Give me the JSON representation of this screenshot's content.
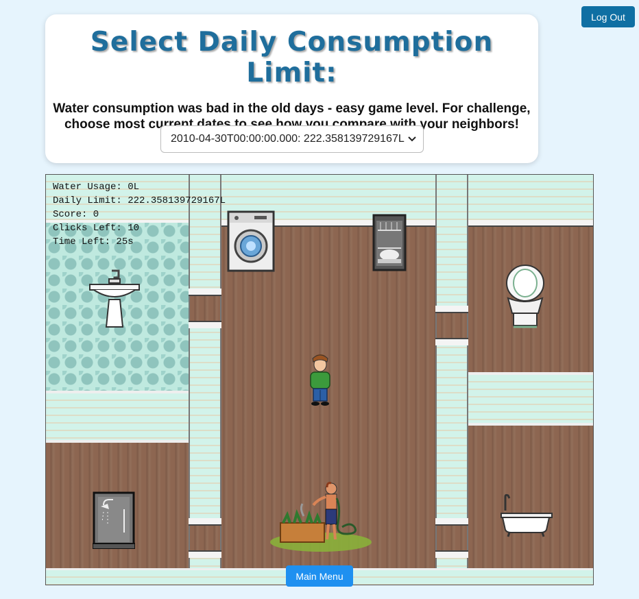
{
  "header": {
    "logout_label": "Log Out"
  },
  "card": {
    "title": "Select Daily Consumption Limit:",
    "description": "Water consumption was bad in the old days - easy game level. For challenge, choose most current dates to see how you compare with your neighbors!",
    "select_value": "2010-04-30T00:00:00.000: 222.358139729167L"
  },
  "hud": {
    "water_usage": "Water Usage: 0L",
    "daily_limit": "Daily Limit: 222.358139729167L",
    "score": "Score: 0",
    "clicks_left": "Clicks Left: 10",
    "time_left": "Time Left: 25s"
  },
  "footer": {
    "main_menu_label": "Main Menu"
  },
  "colors": {
    "accent": "#0f6fa3",
    "title": "#1f6e9c",
    "main_menu": "#1e90f0"
  }
}
